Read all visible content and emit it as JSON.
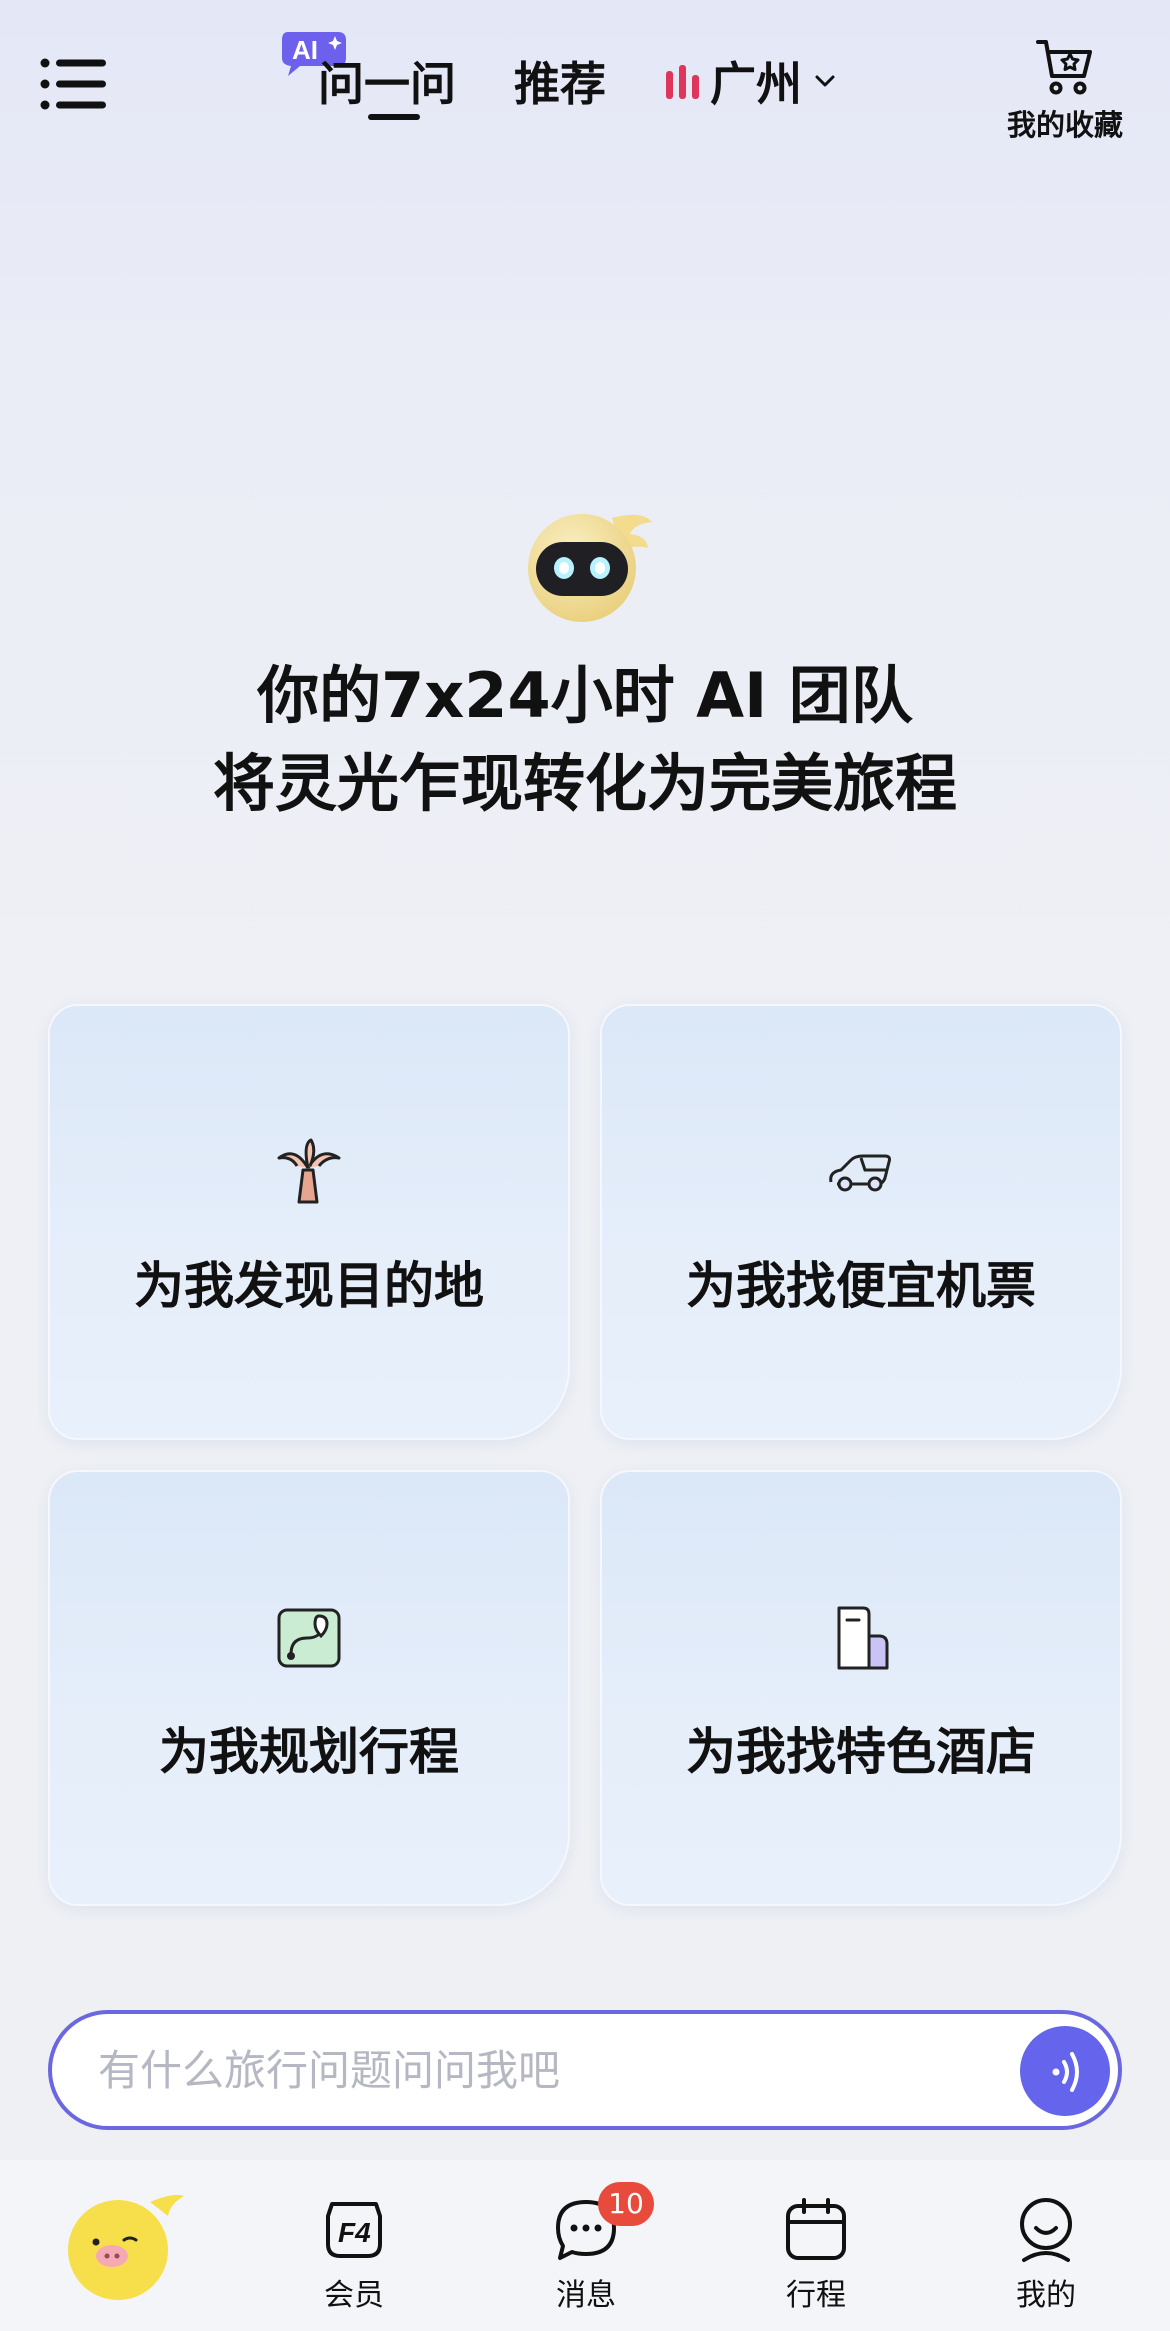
{
  "header": {
    "ai_badge": "AI",
    "tabs": [
      {
        "label": "问一问",
        "active": true
      },
      {
        "label": "推荐",
        "active": false
      }
    ],
    "city": "广州",
    "favorites_label": "我的收藏"
  },
  "hero": {
    "line1": "你的7x24小时 AI 团队",
    "line2": "将灵光乍现转化为完美旅程"
  },
  "cards": [
    {
      "label": "为我发现目的地",
      "icon": "palm-tree-icon"
    },
    {
      "label": "为我找便宜机票",
      "icon": "plane-icon"
    },
    {
      "label": "为我规划行程",
      "icon": "map-route-icon"
    },
    {
      "label": "为我找特色酒店",
      "icon": "hotel-building-icon"
    }
  ],
  "ask": {
    "placeholder": "有什么旅行问题问问我吧",
    "value": ""
  },
  "tabbar": {
    "items": [
      {
        "label": "会员",
        "icon": "f4-member-icon"
      },
      {
        "label": "消息",
        "icon": "chat-bubble-icon",
        "badge": "10"
      },
      {
        "label": "行程",
        "icon": "calendar-icon"
      },
      {
        "label": "我的",
        "icon": "profile-icon"
      }
    ]
  },
  "colors": {
    "accent": "#6465ec",
    "input_border": "#6b67e0",
    "badge": "#e84a3b",
    "city_bars": "#e0355a"
  }
}
